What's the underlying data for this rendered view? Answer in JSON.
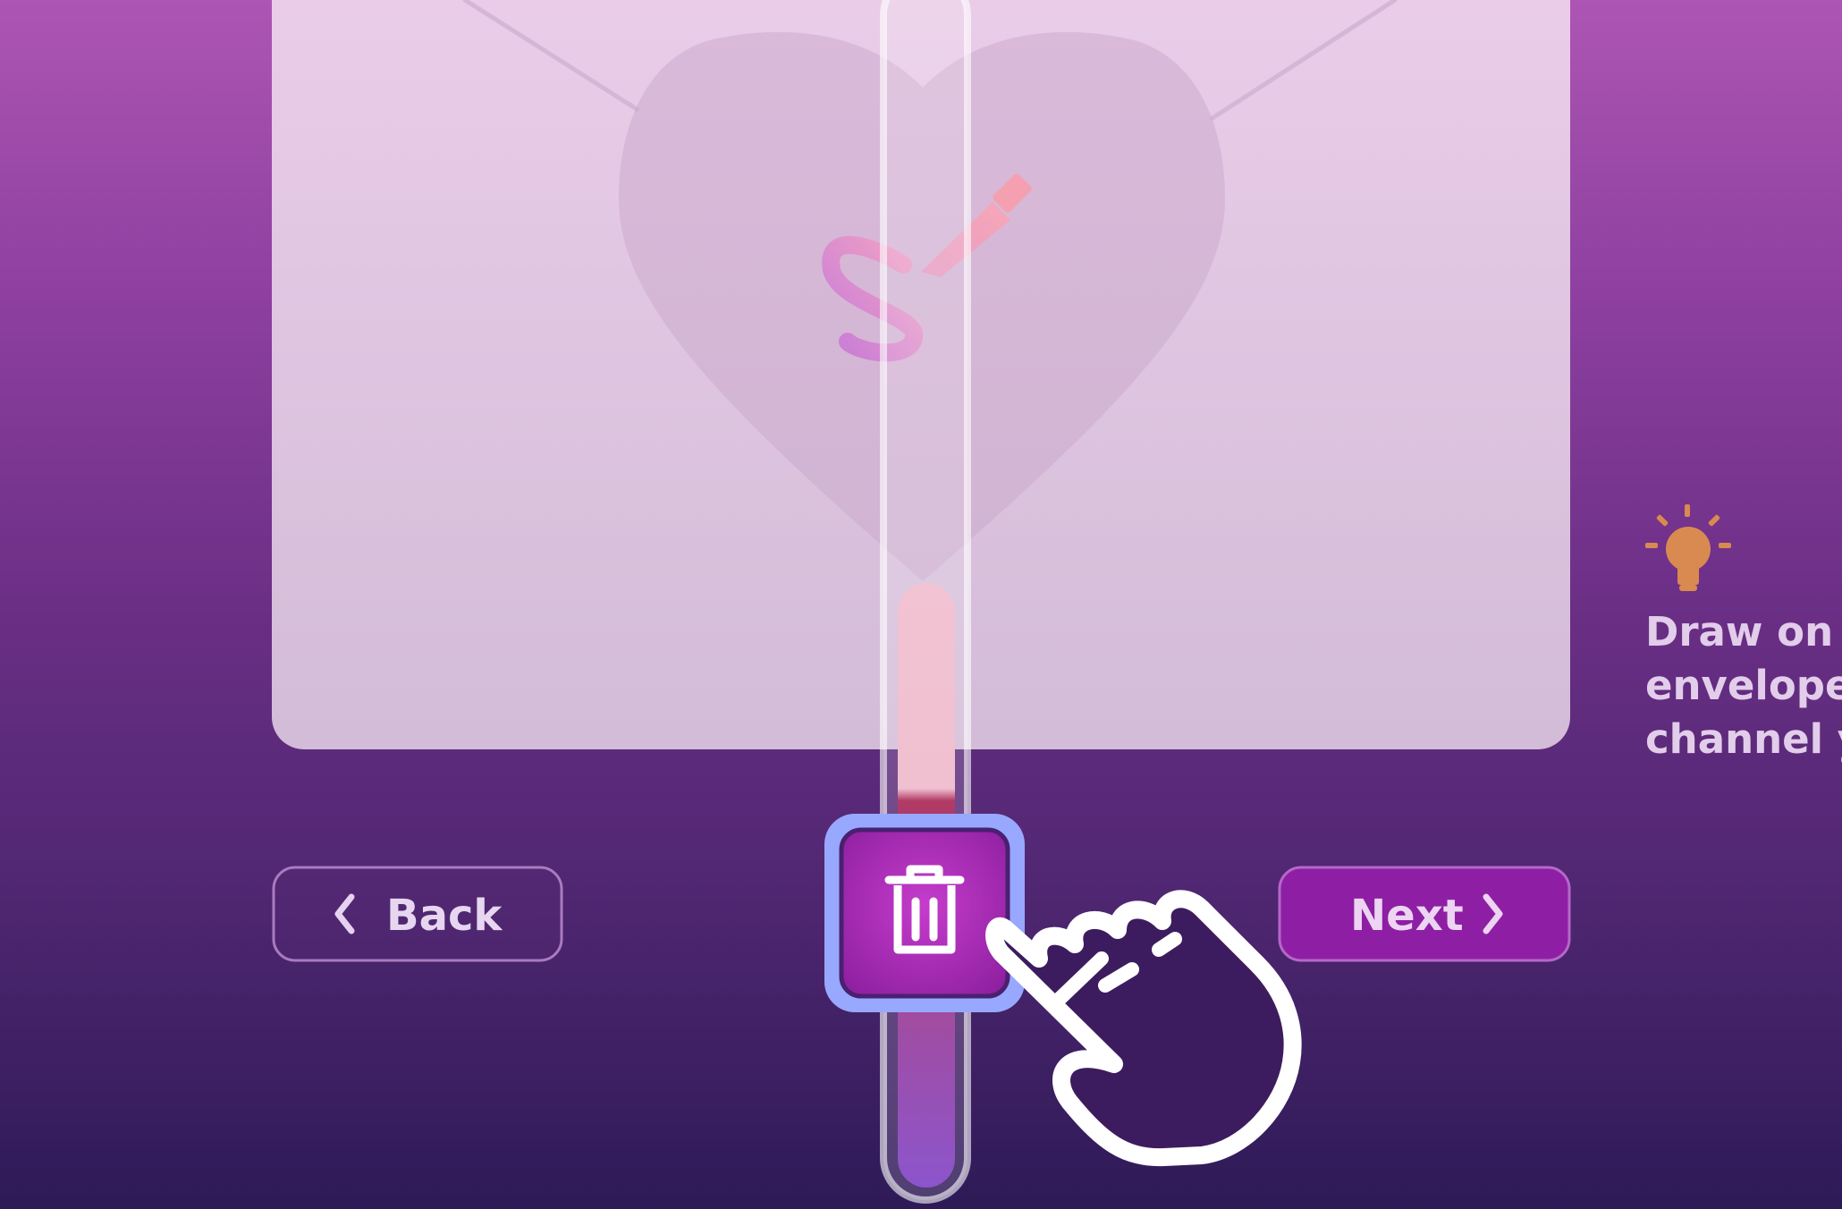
{
  "envelope": {
    "prompt_icon": "squiggle-pencil-icon",
    "background_icon": "heart-icon"
  },
  "nav": {
    "back_label": "Back",
    "next_label": "Next",
    "clear_icon": "trash-icon"
  },
  "tip": {
    "icon": "lightbulb-icon",
    "lines": [
      "Draw on t",
      "envelope",
      "channel y"
    ]
  },
  "overlay": {
    "cursor_icon": "pointing-hand-icon"
  },
  "colors": {
    "accent": "#8e1fa4",
    "focus_ring": "#98a8ff",
    "tip_icon": "#d98a50",
    "envelope_fill": "#e6c9e6"
  }
}
